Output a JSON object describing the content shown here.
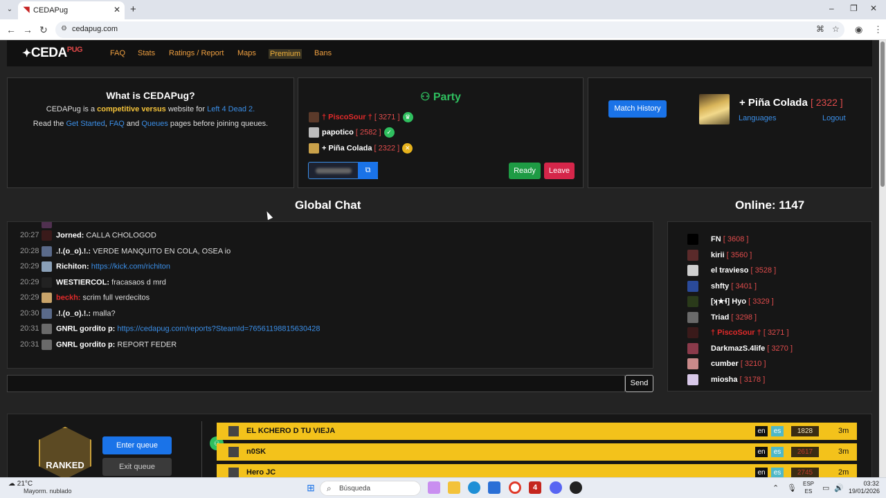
{
  "browser": {
    "tab_title": "CEDAPug",
    "url": "cedapug.com"
  },
  "nav": {
    "logo": "CEDA",
    "logo_suffix": "PUG",
    "links": [
      "FAQ",
      "Stats",
      "Ratings / Report",
      "Maps",
      "Premium",
      "Bans"
    ]
  },
  "info": {
    "heading": "What is CEDAPug?",
    "line1_a": "CEDAPug is a ",
    "line1_b": "competitive versus",
    "line1_c": " website for ",
    "line1_d": "Left 4 Dead 2.",
    "line2_a": "Read the ",
    "line2_b": "Get Started",
    "line2_c": ", ",
    "line2_d": "FAQ",
    "line2_e": " and ",
    "line2_f": "Queues",
    "line2_g": " pages before joining queues."
  },
  "party": {
    "heading": "Party",
    "members": [
      {
        "name": "† PiscoSour †",
        "elo": "[ 3271 ]",
        "red": true,
        "badge_color": "#2fbf5f",
        "badge_icon": "crown-icon"
      },
      {
        "name": "papotico",
        "elo": "[ 2582 ]",
        "red": false,
        "badge_color": "#2fbf5f",
        "badge_icon": "check-icon"
      },
      {
        "name": "+ Piña Colada",
        "elo": "[ 2322 ]",
        "red": false,
        "badge_color": "#e6b21c",
        "badge_icon": "x-icon"
      }
    ],
    "ready_label": "Ready",
    "leave_label": "Leave"
  },
  "user": {
    "match_history": "Match History",
    "name": "+ Piña Colada",
    "elo": "[ 2322 ]",
    "languages": "Languages",
    "logout": "Logout"
  },
  "chat": {
    "title": "Global Chat",
    "online": "Online: 1147",
    "messages": [
      {
        "time": "20:27",
        "name": "Jorned:",
        "msg": "CALLA CHOLOGOD",
        "red": false,
        "link": false
      },
      {
        "time": "20:28",
        "name": ".!.(o_o).!.:",
        "msg": "VERDE MANQUITO EN COLA, OSEA io",
        "red": false,
        "link": false
      },
      {
        "time": "20:29",
        "name": "Richiton:",
        "msg": "https://kick.com/richiton",
        "red": false,
        "link": true
      },
      {
        "time": "20:29",
        "name": "WESTIERCOL:",
        "msg": "fracasaos d mrd",
        "red": false,
        "link": false
      },
      {
        "time": "20:29",
        "name": "beckh:",
        "msg": "scrim full verdecitos",
        "red": true,
        "link": false
      },
      {
        "time": "20:30",
        "name": ".!.(o_o).!.:",
        "msg": "malla?",
        "red": false,
        "link": false
      },
      {
        "time": "20:31",
        "name": "GNRL gordito p:",
        "msg": "https://cedapug.com/reports?SteamId=76561198815630428",
        "red": false,
        "link": true
      },
      {
        "time": "20:31",
        "name": "GNRL gordito p:",
        "msg": "REPORT FEDER",
        "red": false,
        "link": false
      }
    ],
    "send_label": "Send"
  },
  "online_list": [
    {
      "name": "FN",
      "elo": "[ 3608 ]",
      "red": false
    },
    {
      "name": "kirii",
      "elo": "[ 3560 ]",
      "red": false
    },
    {
      "name": "el travieso",
      "elo": "[ 3528 ]",
      "red": false
    },
    {
      "name": "shfty",
      "elo": "[ 3401 ]",
      "red": false
    },
    {
      "name": "[ʞ★ɬ] Hyo",
      "elo": "[ 3329 ]",
      "red": false
    },
    {
      "name": "Triad",
      "elo": "[ 3298 ]",
      "red": false
    },
    {
      "name": "† PiscoSour †",
      "elo": "[ 3271 ]",
      "red": true
    },
    {
      "name": "DarkmazS.4life",
      "elo": "[ 3270 ]",
      "red": false
    },
    {
      "name": "cumber",
      "elo": "[ 3210 ]",
      "red": false
    },
    {
      "name": "miosha",
      "elo": "[ 3178 ]",
      "red": false
    }
  ],
  "queue": {
    "rank": "RANKED",
    "enter": "Enter queue",
    "exit": "Exit queue",
    "rows": [
      {
        "name": "EL KCHERO D TU VIEJA",
        "flags": [
          "en",
          "es"
        ],
        "elo": "1828",
        "time": "3m"
      },
      {
        "name": "n0SK",
        "flags": [
          "en",
          "es"
        ],
        "elo": "2617",
        "time": "3m"
      },
      {
        "name": "Hero JC",
        "flags": [
          "en",
          "es"
        ],
        "elo": "2745",
        "time": "2m"
      }
    ]
  },
  "taskbar": {
    "temp": "21°C",
    "weather": "Mayorm. nublado",
    "search": "Búsqueda",
    "lang1": "ESP",
    "lang2": "ES",
    "time": "03:32",
    "date": "19/01/2026"
  }
}
